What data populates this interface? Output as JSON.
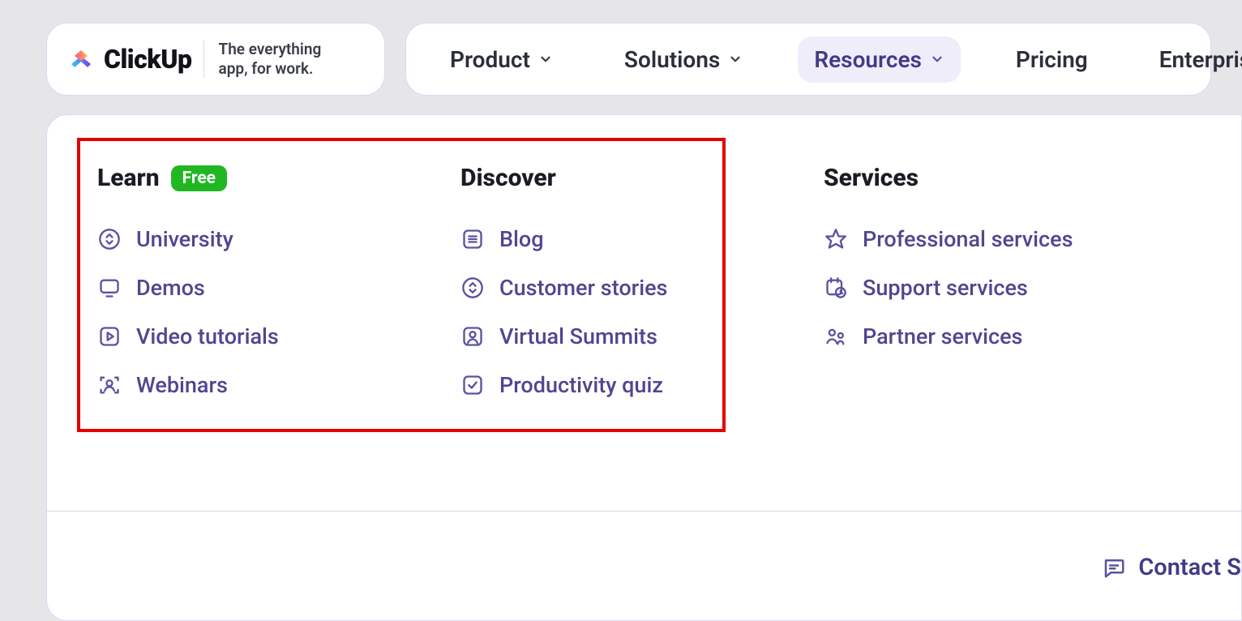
{
  "brand": {
    "name": "ClickUp",
    "tagline_line1": "The everything",
    "tagline_line2": "app, for work."
  },
  "nav": {
    "items": [
      {
        "label": "Product",
        "has_chevron": true,
        "active": false
      },
      {
        "label": "Solutions",
        "has_chevron": true,
        "active": false
      },
      {
        "label": "Resources",
        "has_chevron": true,
        "active": true
      },
      {
        "label": "Pricing",
        "has_chevron": false,
        "active": false
      },
      {
        "label": "Enterprise",
        "has_chevron": false,
        "active": false
      }
    ]
  },
  "dropdown": {
    "columns": [
      {
        "heading": "Learn",
        "badge": "Free",
        "items": [
          {
            "icon": "chevrons-circle-icon",
            "label": "University"
          },
          {
            "icon": "monitor-icon",
            "label": "Demos"
          },
          {
            "icon": "play-square-icon",
            "label": "Video tutorials"
          },
          {
            "icon": "people-focus-icon",
            "label": "Webinars"
          }
        ]
      },
      {
        "heading": "Discover",
        "badge": null,
        "items": [
          {
            "icon": "lines-square-icon",
            "label": "Blog"
          },
          {
            "icon": "chevrons-circle-icon",
            "label": "Customer stories"
          },
          {
            "icon": "person-square-icon",
            "label": "Virtual Summits"
          },
          {
            "icon": "check-square-icon",
            "label": "Productivity quiz"
          }
        ]
      },
      {
        "heading": "Services",
        "badge": null,
        "items": [
          {
            "icon": "star-icon",
            "label": "Professional services"
          },
          {
            "icon": "calendar-clock-icon",
            "label": "Support services"
          },
          {
            "icon": "people-icon",
            "label": "Partner services"
          }
        ]
      }
    ]
  },
  "footer": {
    "contact_label": "Contact S"
  }
}
